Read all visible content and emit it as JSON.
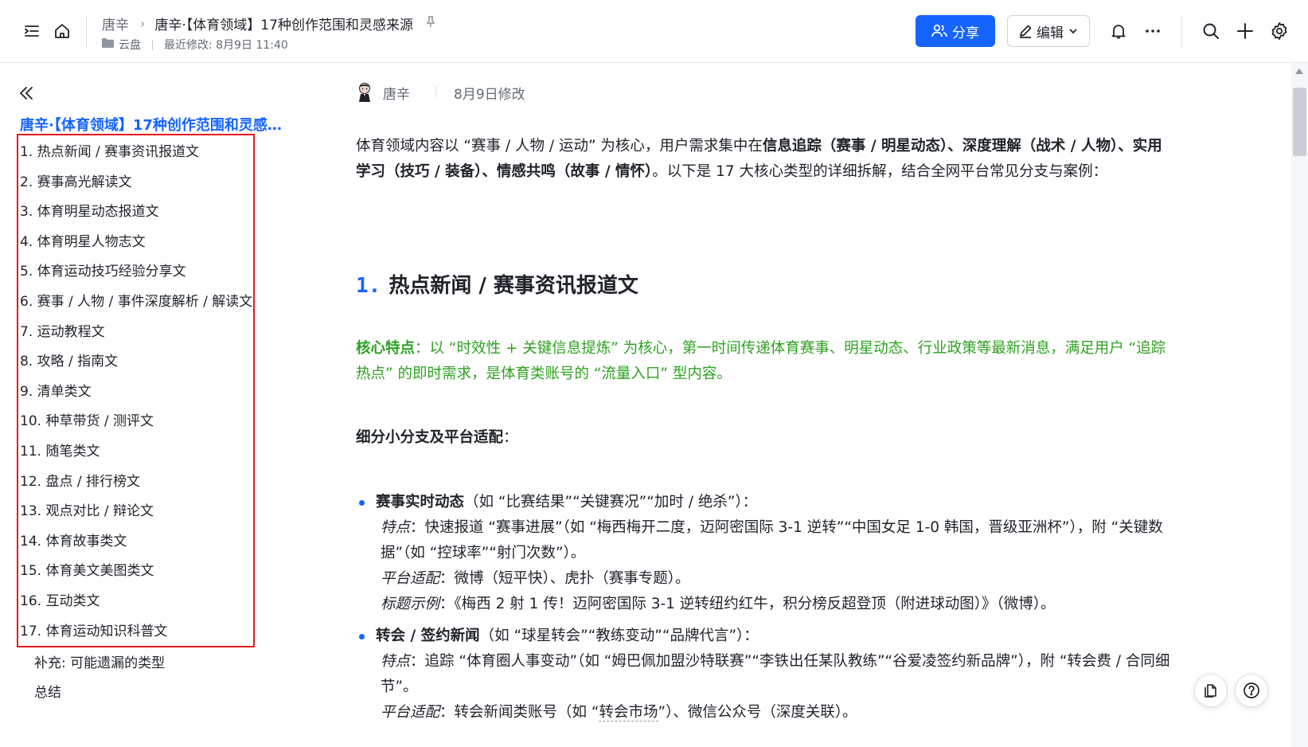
{
  "header": {
    "breadcrumb_home": "唐辛",
    "breadcrumb_doc": "唐辛·【体育领域】17种创作范围和灵感来源",
    "location": "云盘",
    "last_modified": "最近修改: 8月9日 11:40",
    "share_label": "分享",
    "edit_label": "编辑"
  },
  "toc": {
    "title": "唐辛·【体育领域】17种创作范围和灵感来源",
    "items": [
      "1. 热点新闻 / 赛事资讯报道文",
      "2. 赛事高光解读文",
      "3. 体育明星动态报道文",
      "4. 体育明星人物志文",
      "5. 体育运动技巧经验分享文",
      "6. 赛事 / 人物 / 事件深度解析 / 解读文",
      "7. 运动教程文",
      "8. 攻略 / 指南文",
      "9. 清单类文",
      "10. 种草带货 / 测评文",
      "11. 随笔类文",
      "12. 盘点 / 排行榜文",
      "13. 观点对比 / 辩论文",
      "14. 体育故事类文",
      "15. 体育美文美图类文",
      "16. 互动类文",
      "17. 体育运动知识科普文"
    ],
    "sub_items": [
      "补充: 可能遗漏的类型",
      "总结"
    ]
  },
  "doc": {
    "author": "唐辛",
    "modified": "8月9日修改",
    "intro_prefix": "体育领域内容以 “赛事 / 人物 / 运动” 为核心，用户需求集中在",
    "intro_bold": "信息追踪（赛事 / 明星动态）、深度理解（战术 / 人物）、实用学习（技巧 / 装备）、情感共鸣（故事 / 情怀）",
    "intro_suffix": "。以下是 17 大核心类型的详细拆解，结合全网平台常见分支与案例：",
    "h1_num": "1.",
    "h1_text": "热点新闻 / 赛事资讯报道文",
    "core_label": "核心特点",
    "core_text": "：以 “时效性 + 关键信息提炼” 为核心，第一时间传递体育赛事、明星动态、行业政策等最新消息，满足用户 “追踪热点” 的即时需求，是体育类账号的 “流量入口” 型内容。",
    "sub_heading": "细分小分支及平台适配",
    "sub_heading_colon": "：",
    "bullets": [
      {
        "title": "赛事实时动态",
        "title_note": "（如 “比赛结果”“关键赛况”“加时 / 绝杀”）：",
        "feature_label": "特点",
        "feature_text": "：快速报道 “赛事进展”（如 “梅西梅开二度，迈阿密国际 3-1 逆转”“中国女足 1-0 韩国，晋级亚洲杯”），附 “关键数据”（如 “控球率”“射门次数”）。",
        "platform_label": "平台适配",
        "platform_text": "：微博（短平快）、虎扑（赛事专题）。",
        "example_label": "标题示例",
        "example_text": "：《梅西 2 射 1 传！迈阿密国际 3-1 逆转纽约红牛，积分榜反超登顶（附进球动图）》（微博）。"
      },
      {
        "title": "转会 / 签约新闻",
        "title_note": "（如 “球星转会”“教练变动”“品牌代言”）：",
        "feature_label": "特点",
        "feature_text": "：追踪 “体育圈人事变动”（如 “姆巴佩加盟沙特联赛”“李铁出任某队教练”“谷爱凌签约新品牌”），附 “转会费 / 合同细节”。",
        "platform_label": "平台适配",
        "platform_text_a": "：转会新闻类账号（如 “",
        "platform_dotted": "转会市场",
        "platform_text_b": "”）、微信公众号（深度关联）。"
      }
    ]
  },
  "colors": {
    "accent": "#1664ff",
    "green": "#2ea121",
    "highlight_box": "#e5191a"
  }
}
